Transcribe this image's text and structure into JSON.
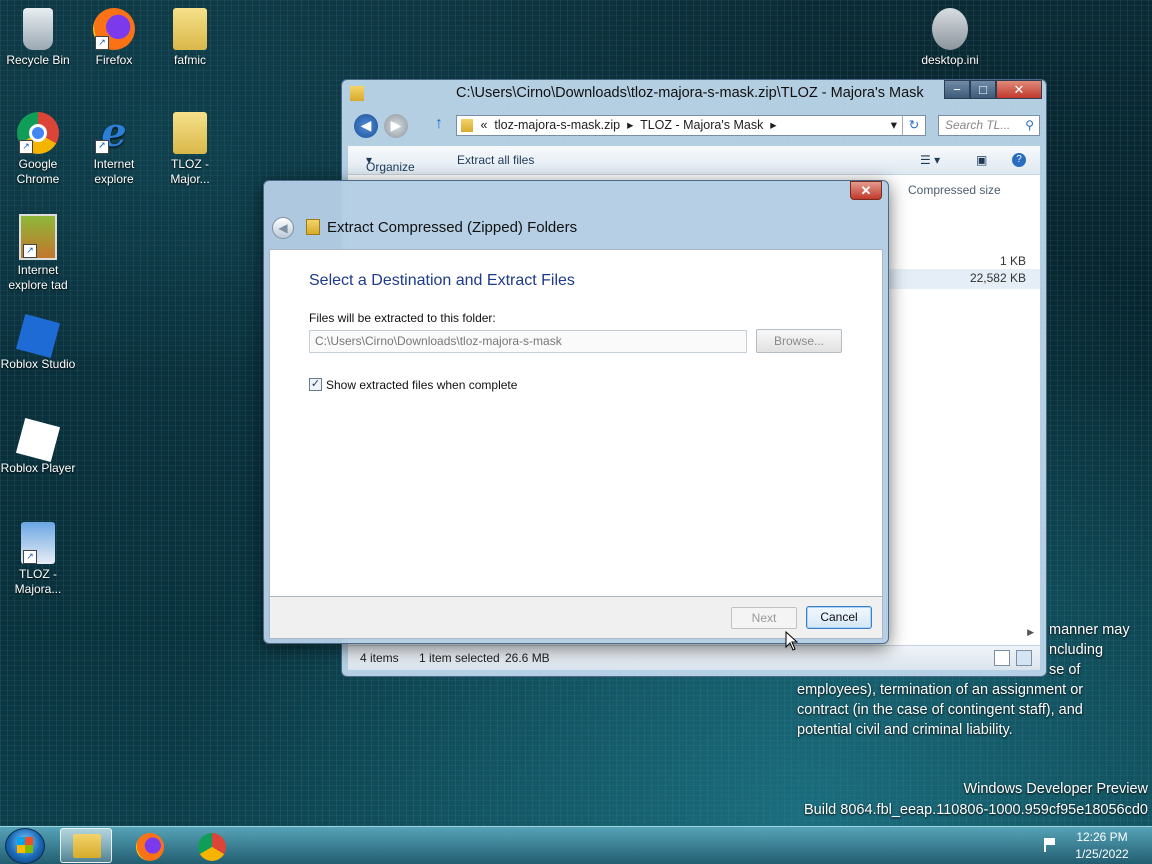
{
  "desktop": {
    "icons": [
      {
        "label": "Recycle Bin",
        "icon": "recycle-bin-icon"
      },
      {
        "label": "Firefox",
        "icon": "firefox-icon"
      },
      {
        "label": "fafmic",
        "icon": "folder-icon"
      },
      {
        "label": "desktop.ini",
        "icon": "settings-file-icon"
      },
      {
        "label": "Google Chrome",
        "icon": "chrome-icon"
      },
      {
        "label": "Internet explore",
        "icon": "internet-explorer-icon"
      },
      {
        "label": "TLOZ - Major...",
        "icon": "folder-icon"
      },
      {
        "label": "Internet explore tad",
        "icon": "game-icon"
      },
      {
        "label": "Roblox Studio",
        "icon": "roblox-studio-icon"
      },
      {
        "label": "Roblox Player",
        "icon": "roblox-player-icon"
      },
      {
        "label": "TLOZ - Majora...",
        "icon": "installer-icon"
      }
    ],
    "watermark_lines": [
      "manner may",
      "ncluding",
      "se of",
      "employees), termination of an assignment or",
      "contract (in the case of contingent staff), and",
      "potential civil and criminal liability."
    ],
    "build_line1": "Windows Developer Preview",
    "build_line2": "Build 8064.fbl_eeap.110806-1000.959cf95e18056cd0"
  },
  "explorer": {
    "title": "C:\\Users\\Cirno\\Downloads\\tloz-majora-s-mask.zip\\TLOZ - Majora's Mask",
    "breadcrumb": [
      "«",
      "tloz-majora-s-mask.zip",
      "▸",
      "TLOZ - Majora's Mask",
      "▸"
    ],
    "search_placeholder": "Search TL...",
    "organize_label": "Organize",
    "extract_all_label": "Extract all files",
    "column_compressed": "Compressed size",
    "sizes": [
      "1 KB",
      "22,582 KB"
    ],
    "status_items": "4 items",
    "status_selected": "1 item selected",
    "status_size": "26.6 MB"
  },
  "dialog": {
    "title": "Extract Compressed (Zipped) Folders",
    "heading": "Select a Destination and Extract Files",
    "folder_label": "Files will be extracted to this folder:",
    "path_value": "C:\\Users\\Cirno\\Downloads\\tloz-majora-s-mask",
    "browse_label": "Browse...",
    "show_files_label": "Show extracted files when complete",
    "show_files_checked": true,
    "next_label": "Next",
    "cancel_label": "Cancel"
  },
  "taskbar": {
    "pinned": [
      "windows-explorer-icon",
      "firefox-icon",
      "chrome-icon"
    ],
    "time": "12:26 PM",
    "date": "1/25/2022"
  },
  "colors": {
    "accent": "#1e3a8a",
    "close_red": "#c0392b",
    "taskbar": "#2f7f93"
  }
}
